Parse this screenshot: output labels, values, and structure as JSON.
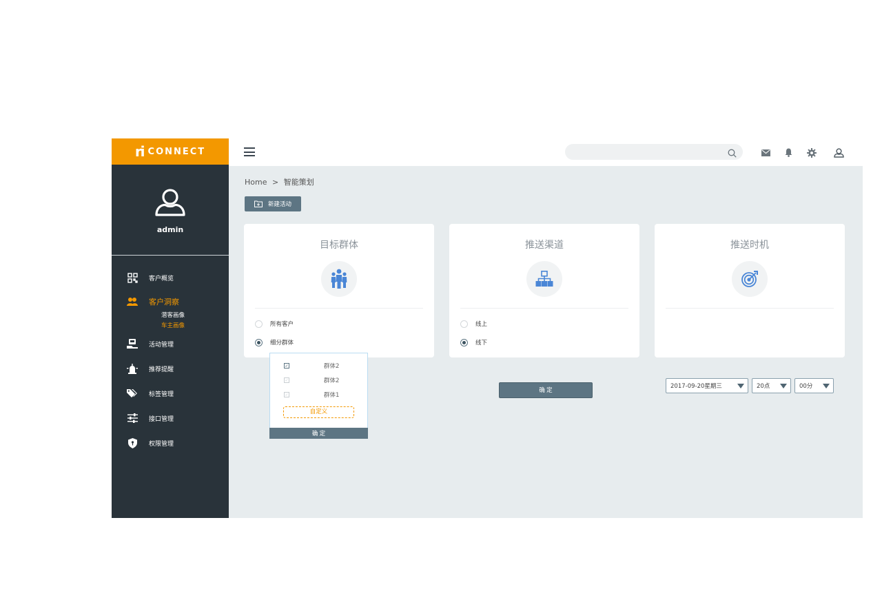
{
  "brand": {
    "mark": "ri",
    "name": "CONNECT",
    "color": "#f39800"
  },
  "user": {
    "name": "admin",
    "avatar_icon": "user-outline-icon"
  },
  "sidebar": {
    "items": [
      {
        "label": "客户概览",
        "icon": "grid-icon"
      },
      {
        "label": "客户洞察",
        "icon": "users-icon",
        "active": true,
        "children": [
          {
            "label": "潜客画像"
          },
          {
            "label": "车主画像",
            "current": true
          }
        ]
      },
      {
        "label": "活动管理",
        "icon": "screen-hand-icon"
      },
      {
        "label": "推荐提醒",
        "icon": "alarm-light-icon"
      },
      {
        "label": "标签管理",
        "icon": "tags-icon"
      },
      {
        "label": "接口管理",
        "icon": "sliders-icon"
      },
      {
        "label": "权限管理",
        "icon": "shield-icon"
      }
    ]
  },
  "header": {
    "search": {
      "placeholder": "",
      "icon": "search-icon"
    },
    "icons": [
      "mail-icon",
      "bell-icon",
      "gear-icon",
      "user-icon"
    ]
  },
  "breadcrumb": {
    "home": "Home",
    "separator": ">",
    "current": "智能策划"
  },
  "toolbar": {
    "new_label": "新建活动"
  },
  "cards": {
    "audience": {
      "title": "目标群体",
      "icon": "group-icon",
      "options": [
        {
          "label": "所有客户",
          "checked": false
        },
        {
          "label": "细分群体",
          "checked": true
        }
      ]
    },
    "channel": {
      "title": "推送渠道",
      "icon": "hierarchy-icon",
      "options": [
        {
          "label": "线上",
          "checked": false
        },
        {
          "label": "线下",
          "checked": true
        }
      ]
    },
    "timing": {
      "title": "推送时机",
      "icon": "target-icon",
      "date": "2017-09-20星期三",
      "hour": "20点",
      "minute": "00分"
    }
  },
  "dropdown": {
    "items": [
      {
        "label": "群体2",
        "checked": true
      },
      {
        "label": "群体2",
        "checked": false
      },
      {
        "label": "群体1",
        "checked": false
      }
    ],
    "custom_label": "自定义",
    "confirm_label": "确 定"
  },
  "confirm_label": "确 定"
}
